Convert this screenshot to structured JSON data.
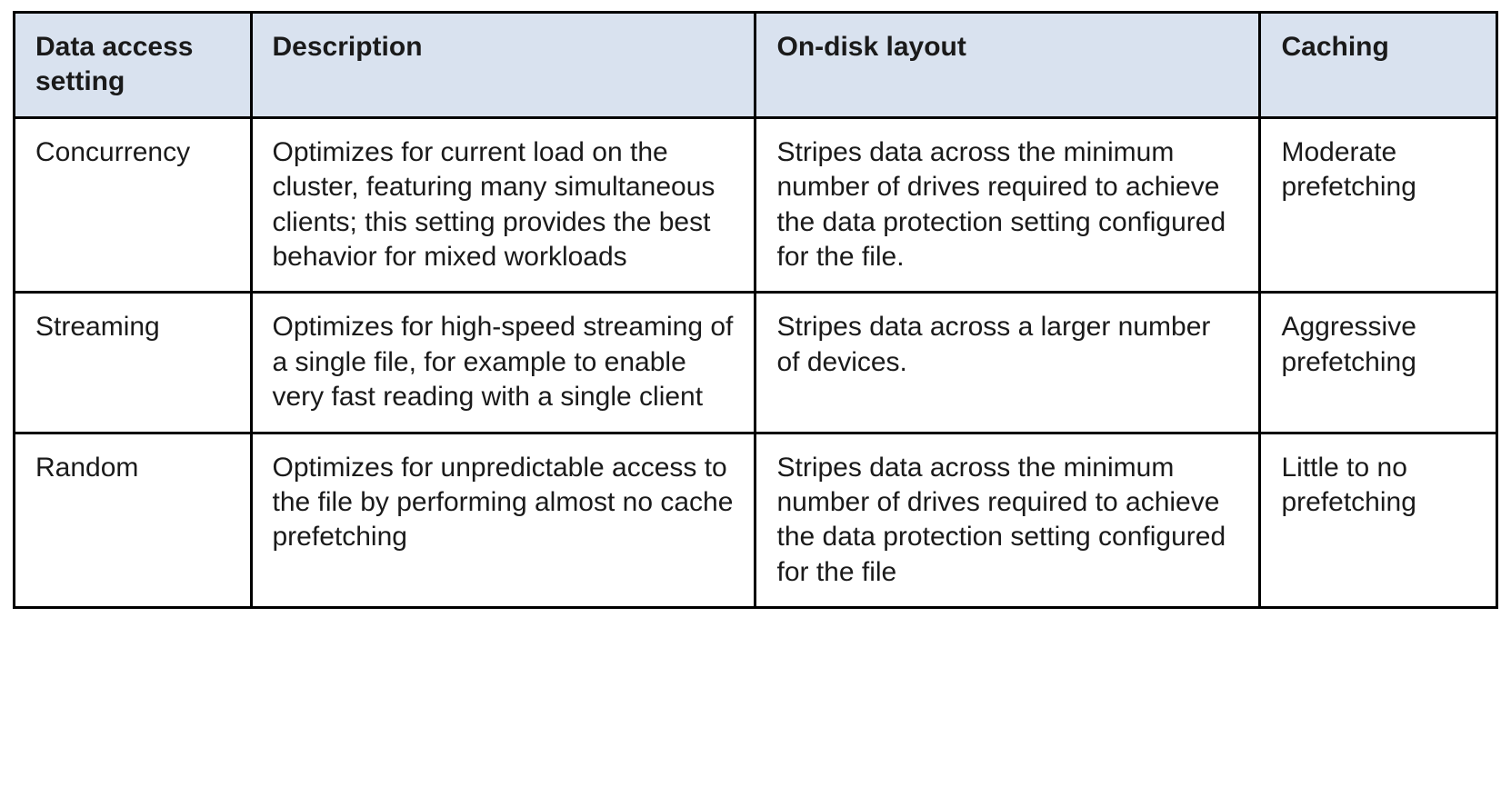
{
  "table": {
    "headers": [
      "Data access setting",
      "Description",
      "On-disk layout",
      "Caching"
    ],
    "rows": [
      {
        "setting": "Concurrency",
        "description": "Optimizes for current load on the cluster, featuring many simultaneous clients; this setting provides the best behavior for mixed workloads",
        "layout": "Stripes data across the minimum number of drives required to achieve the data protection setting configured for the file.",
        "caching": "Moderate prefetching"
      },
      {
        "setting": "Streaming",
        "description": "Optimizes for high-speed streaming of a single file, for example to enable very fast reading with a single client",
        "layout": "Stripes data across a larger number of devices.",
        "caching": "Aggressive prefetching"
      },
      {
        "setting": "Random",
        "description": "Optimizes for unpredictable access to the file by performing almost no cache prefetching",
        "layout": "Stripes data across the minimum number of drives required to achieve the data protection setting configured for the file",
        "caching": "Little to no prefetching"
      }
    ]
  },
  "chart_data": {
    "type": "table",
    "columns": [
      "Data access setting",
      "Description",
      "On-disk layout",
      "Caching"
    ],
    "rows": [
      [
        "Concurrency",
        "Optimizes for current load on the cluster, featuring many simultaneous clients; this setting provides the best behavior for mixed workloads",
        "Stripes data across the minimum number of drives required to achieve the data protection setting configured for the file.",
        "Moderate prefetching"
      ],
      [
        "Streaming",
        "Optimizes for high-speed streaming of a single file, for example to enable very fast reading with a single client",
        "Stripes data across a larger number of devices.",
        "Aggressive prefetching"
      ],
      [
        "Random",
        "Optimizes for unpredictable access to the file by performing almost no cache prefetching",
        "Stripes data across the minimum number of drives required to achieve the data protection setting configured for the file",
        "Little to no prefetching"
      ]
    ]
  }
}
